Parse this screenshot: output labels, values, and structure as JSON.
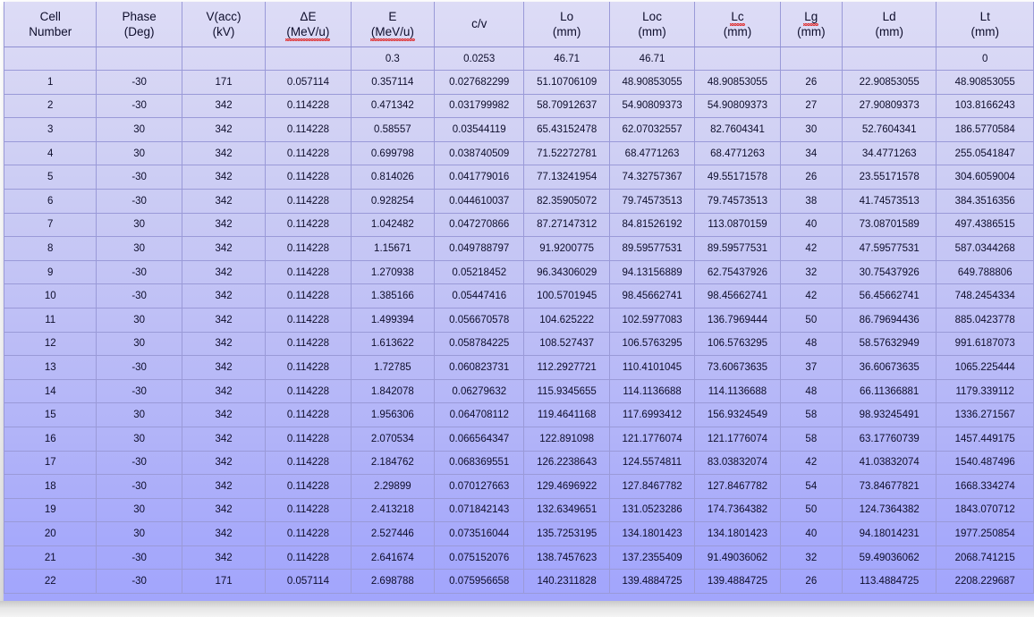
{
  "table": {
    "columns": [
      {
        "key": "cell",
        "line1": "Cell",
        "line2": "Number",
        "squiggle1": false,
        "squiggle2": false
      },
      {
        "key": "phase",
        "line1": "Phase",
        "line2": "(Deg)",
        "squiggle1": false,
        "squiggle2": false
      },
      {
        "key": "vacc",
        "line1": "V(acc)",
        "line2": "(kV)",
        "squiggle1": false,
        "squiggle2": false
      },
      {
        "key": "de",
        "line1": "ΔE",
        "line2": "(MeV/u)",
        "squiggle1": false,
        "squiggle2": true
      },
      {
        "key": "e",
        "line1": "E",
        "line2": "(MeV/u)",
        "squiggle1": false,
        "squiggle2": true
      },
      {
        "key": "cv",
        "line1": "c/v",
        "line2": "",
        "squiggle1": false,
        "squiggle2": false
      },
      {
        "key": "lo",
        "line1": "Lo",
        "line2": "(mm)",
        "squiggle1": false,
        "squiggle2": false
      },
      {
        "key": "loc",
        "line1": "Loc",
        "line2": "(mm)",
        "squiggle1": false,
        "squiggle2": false
      },
      {
        "key": "lc",
        "line1": "Lc",
        "line2": "(mm)",
        "squiggle1": true,
        "squiggle2": false
      },
      {
        "key": "lg",
        "line1": "Lg",
        "line2": "(mm)",
        "squiggle1": true,
        "squiggle2": false
      },
      {
        "key": "ld",
        "line1": "Ld",
        "line2": "(mm)",
        "squiggle1": false,
        "squiggle2": false
      },
      {
        "key": "lt",
        "line1": "Lt",
        "line2": "(mm)",
        "squiggle1": false,
        "squiggle2": false
      }
    ],
    "constants_row": [
      "",
      "",
      "",
      "",
      "0.3",
      "0.0253",
      "46.71",
      "46.71",
      "",
      "",
      "",
      "0"
    ],
    "rows": [
      [
        "1",
        "-30",
        "171",
        "0.057114",
        "0.357114",
        "0.027682299",
        "51.10706109",
        "48.90853055",
        "48.90853055",
        "26",
        "22.90853055",
        "48.90853055"
      ],
      [
        "2",
        "-30",
        "342",
        "0.114228",
        "0.471342",
        "0.031799982",
        "58.70912637",
        "54.90809373",
        "54.90809373",
        "27",
        "27.90809373",
        "103.8166243"
      ],
      [
        "3",
        "30",
        "342",
        "0.114228",
        "0.58557",
        "0.03544119",
        "65.43152478",
        "62.07032557",
        "82.7604341",
        "30",
        "52.7604341",
        "186.5770584"
      ],
      [
        "4",
        "30",
        "342",
        "0.114228",
        "0.699798",
        "0.038740509",
        "71.52272781",
        "68.4771263",
        "68.4771263",
        "34",
        "34.4771263",
        "255.0541847"
      ],
      [
        "5",
        "-30",
        "342",
        "0.114228",
        "0.814026",
        "0.041779016",
        "77.13241954",
        "74.32757367",
        "49.55171578",
        "26",
        "23.55171578",
        "304.6059004"
      ],
      [
        "6",
        "-30",
        "342",
        "0.114228",
        "0.928254",
        "0.044610037",
        "82.35905072",
        "79.74573513",
        "79.74573513",
        "38",
        "41.74573513",
        "384.3516356"
      ],
      [
        "7",
        "30",
        "342",
        "0.114228",
        "1.042482",
        "0.047270866",
        "87.27147312",
        "84.81526192",
        "113.0870159",
        "40",
        "73.08701589",
        "497.4386515"
      ],
      [
        "8",
        "30",
        "342",
        "0.114228",
        "1.15671",
        "0.049788797",
        "91.9200775",
        "89.59577531",
        "89.59577531",
        "42",
        "47.59577531",
        "587.0344268"
      ],
      [
        "9",
        "-30",
        "342",
        "0.114228",
        "1.270938",
        "0.05218452",
        "96.34306029",
        "94.13156889",
        "62.75437926",
        "32",
        "30.75437926",
        "649.788806"
      ],
      [
        "10",
        "-30",
        "342",
        "0.114228",
        "1.385166",
        "0.05447416",
        "100.5701945",
        "98.45662741",
        "98.45662741",
        "42",
        "56.45662741",
        "748.2454334"
      ],
      [
        "11",
        "30",
        "342",
        "0.114228",
        "1.499394",
        "0.056670578",
        "104.625222",
        "102.5977083",
        "136.7969444",
        "50",
        "86.79694436",
        "885.0423778"
      ],
      [
        "12",
        "30",
        "342",
        "0.114228",
        "1.613622",
        "0.058784225",
        "108.527437",
        "106.5763295",
        "106.5763295",
        "48",
        "58.57632949",
        "991.6187073"
      ],
      [
        "13",
        "-30",
        "342",
        "0.114228",
        "1.72785",
        "0.060823731",
        "112.2927721",
        "110.4101045",
        "73.60673635",
        "37",
        "36.60673635",
        "1065.225444"
      ],
      [
        "14",
        "-30",
        "342",
        "0.114228",
        "1.842078",
        "0.06279632",
        "115.9345655",
        "114.1136688",
        "114.1136688",
        "48",
        "66.11366881",
        "1179.339112"
      ],
      [
        "15",
        "30",
        "342",
        "0.114228",
        "1.956306",
        "0.064708112",
        "119.4641168",
        "117.6993412",
        "156.9324549",
        "58",
        "98.93245491",
        "1336.271567"
      ],
      [
        "16",
        "30",
        "342",
        "0.114228",
        "2.070534",
        "0.066564347",
        "122.891098",
        "121.1776074",
        "121.1776074",
        "58",
        "63.17760739",
        "1457.449175"
      ],
      [
        "17",
        "-30",
        "342",
        "0.114228",
        "2.184762",
        "0.068369551",
        "126.2238643",
        "124.5574811",
        "83.03832074",
        "42",
        "41.03832074",
        "1540.487496"
      ],
      [
        "18",
        "-30",
        "342",
        "0.114228",
        "2.29899",
        "0.070127663",
        "129.4696922",
        "127.8467782",
        "127.8467782",
        "54",
        "73.84677821",
        "1668.334274"
      ],
      [
        "19",
        "30",
        "342",
        "0.114228",
        "2.413218",
        "0.071842143",
        "132.6349651",
        "131.0523286",
        "174.7364382",
        "50",
        "124.7364382",
        "1843.070712"
      ],
      [
        "20",
        "30",
        "342",
        "0.114228",
        "2.527446",
        "0.073516044",
        "135.7253195",
        "134.1801423",
        "134.1801423",
        "40",
        "94.18014231",
        "1977.250854"
      ],
      [
        "21",
        "-30",
        "342",
        "0.114228",
        "2.641674",
        "0.075152076",
        "138.7457623",
        "137.2355409",
        "91.49036062",
        "32",
        "59.49036062",
        "2068.741215"
      ],
      [
        "22",
        "-30",
        "171",
        "0.057114",
        "2.698788",
        "0.075956658",
        "140.2311828",
        "139.4884725",
        "139.4884725",
        "26",
        "113.4884725",
        "2208.229687"
      ]
    ]
  },
  "colors": {
    "grid_line": "#9a9ad8",
    "text": "#0d0d2b",
    "fill_top": "#dddcf6",
    "fill_bottom": "#a2a5fc",
    "spellcheck_underline": "#e03030"
  }
}
